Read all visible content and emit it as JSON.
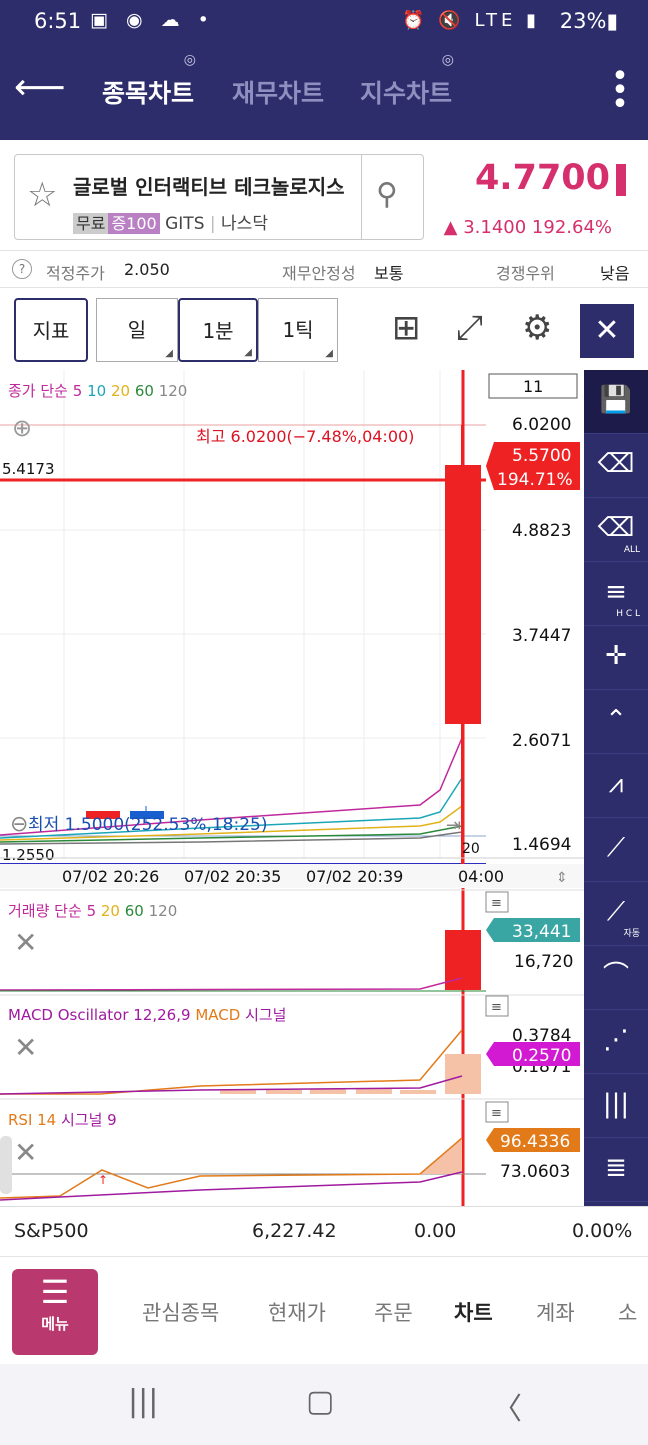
{
  "status": {
    "time": "6:51",
    "left_icons": "▣ ◉ ☁ •",
    "right_icons": "⏰ 🔇 LTE ▮",
    "battery": "23%▮"
  },
  "header": {
    "back_icon": "arrow-left-icon",
    "tabs": [
      {
        "label": "종목차트",
        "active": true
      },
      {
        "label": "재무차트",
        "active": false
      },
      {
        "label": "지수차트",
        "active": false
      }
    ]
  },
  "stock": {
    "name": "글로벌 인터랙티브 테크놀로지스",
    "tag_free": "무료",
    "tag_margin": "증100",
    "ticker": "GITS",
    "market": "나스닥",
    "price": "4.7700",
    "change": "▲ 3.1400  192.64%"
  },
  "info": {
    "fair_label": "적정주가",
    "fair_value": "2.050",
    "stability_label": "재무안정성",
    "stability_value": "보통",
    "competition_label": "경쟁우위",
    "competition_value": "낮음"
  },
  "toolbar": {
    "indicator": "지표",
    "period_day": "일",
    "period_min": "1분",
    "period_tick": "1틱"
  },
  "chart": {
    "legend_price": {
      "label": "종가 단순",
      "ma": [
        "5",
        "10",
        "20",
        "60",
        "120"
      ]
    },
    "legend_volume": {
      "label": "거래량 단순",
      "ma": [
        "5",
        "20",
        "60",
        "120"
      ]
    },
    "legend_macd": {
      "label": "MACD Oscillator 12,26,9",
      "macd": "MACD",
      "signal": "시그널"
    },
    "legend_rsi": {
      "label": "RSI 14",
      "signal": "시그널 9"
    },
    "count_box": "11",
    "high_label": "최고 6.0200(−7.48%,04:00)",
    "low_label": "최저 1.5000(252.53%,18:25)",
    "left_top_value": "5.4173",
    "left_bottom_value": "1.2550",
    "y_ticks": [
      "6.0200",
      "4.8823",
      "3.7447",
      "2.6071",
      "1.4694"
    ],
    "current_price_tag": "5.5700",
    "current_pct_tag": "194.71%",
    "x_ticks": [
      "07/02 20:26",
      "07/02 20:35",
      "07/02 20:39",
      "04:00"
    ],
    "x_corner": "20",
    "volume_tag": "33,441",
    "volume_tick": "16,720",
    "macd_tick_1": "0.3784",
    "macd_tick_2": "0.1871",
    "macd_tag": "0.2570",
    "rsi_tag": "96.4336",
    "rsi_tick": "73.0603"
  },
  "chart_data": {
    "type": "candlestick",
    "y_range": [
      1.255,
      6.02
    ],
    "last_candle": {
      "open": 2.6071,
      "high": 6.02,
      "low": 1.5,
      "close": 5.57
    },
    "volume_last": 33441,
    "macd_last": 0.257,
    "rsi_last": 96.4336
  },
  "right_panel": [
    "save-icon",
    "eraser-icon",
    "eraser-all-icon",
    "hcl-lines-icon",
    "cross-line-icon",
    "peak-icon",
    "zigzag-icon",
    "trend-line-icon",
    "auto-trend-icon",
    "arc-icon",
    "fan-icon",
    "vertical-lines-icon",
    "horizontal-lines-icon"
  ],
  "right_panel_labels": {
    "all": "ALL",
    "auto": "자동",
    "hcl": "H C L"
  },
  "index": {
    "name": "S&P500",
    "value": "6,227.42",
    "change": "0.00",
    "pct": "0.00%"
  },
  "bottom_nav": {
    "menu": "메뉴",
    "items": [
      {
        "label": "관심종목",
        "active": false
      },
      {
        "label": "현재가",
        "active": false
      },
      {
        "label": "주문",
        "active": false
      },
      {
        "label": "차트",
        "active": true
      },
      {
        "label": "계좌",
        "active": false
      },
      {
        "label": "소",
        "active": false
      }
    ]
  },
  "sysnav": {
    "recents": "|||",
    "home": "▢",
    "back": "〈"
  }
}
